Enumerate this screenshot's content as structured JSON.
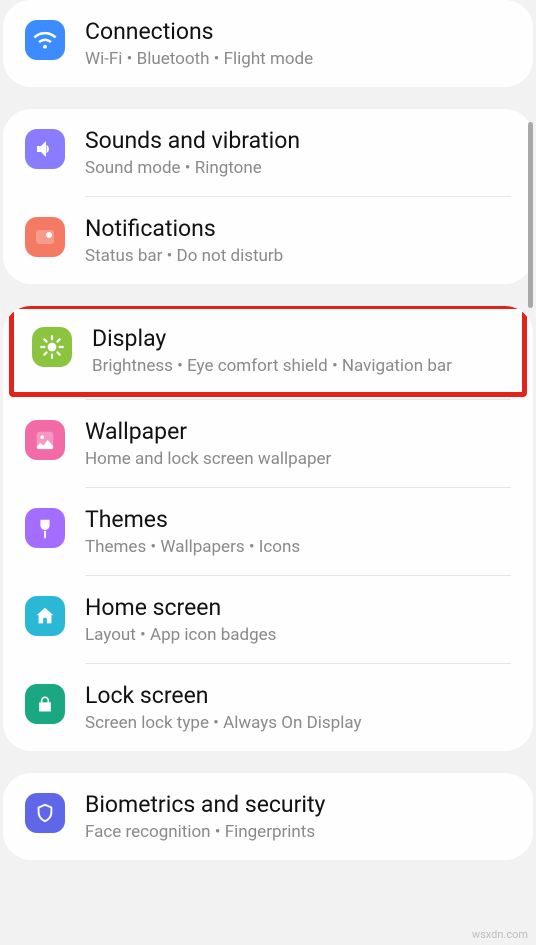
{
  "watermark": "wsxdn.com",
  "groups": [
    {
      "items": [
        {
          "id": "connections",
          "icon": "wifi",
          "color": "#3c8cff",
          "title": "Connections",
          "subtitle": "Wi-Fi  •  Bluetooth  •  Flight mode"
        }
      ]
    },
    {
      "items": [
        {
          "id": "sounds",
          "icon": "speaker",
          "color": "#8a7cff",
          "title": "Sounds and vibration",
          "subtitle": "Sound mode  •  Ringtone"
        },
        {
          "id": "notifications",
          "icon": "notif",
          "color": "#f47a64",
          "title": "Notifications",
          "subtitle": "Status bar  •  Do not disturb"
        }
      ]
    },
    {
      "items": [
        {
          "id": "display",
          "icon": "sun",
          "color": "#8bc53f",
          "title": "Display",
          "subtitle": "Brightness  •  Eye comfort shield  •  Navigation bar",
          "highlight": true
        },
        {
          "id": "wallpaper",
          "icon": "picture",
          "color": "#f26aa6",
          "title": "Wallpaper",
          "subtitle": "Home and lock screen wallpaper"
        },
        {
          "id": "themes",
          "icon": "brush",
          "color": "#a46cff",
          "title": "Themes",
          "subtitle": "Themes  •  Wallpapers  •  Icons"
        },
        {
          "id": "homescreen",
          "icon": "home",
          "color": "#2bb8d6",
          "title": "Home screen",
          "subtitle": "Layout  •  App icon badges"
        },
        {
          "id": "lockscreen",
          "icon": "lock",
          "color": "#1aa883",
          "title": "Lock screen",
          "subtitle": "Screen lock type  •  Always On Display"
        }
      ]
    },
    {
      "items": [
        {
          "id": "biometrics",
          "icon": "shield",
          "color": "#6066e8",
          "title": "Biometrics and security",
          "subtitle": "Face recognition  •  Fingerprints"
        }
      ]
    }
  ]
}
